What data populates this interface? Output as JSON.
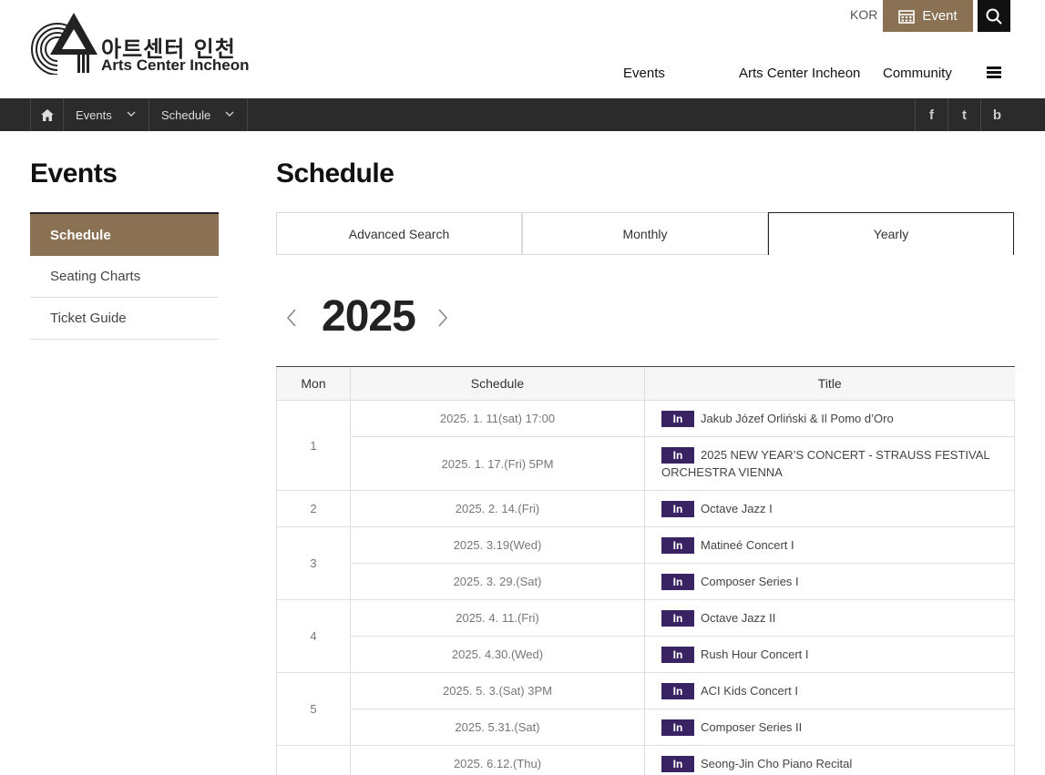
{
  "brand": {
    "name_kr": "아트센터 인천",
    "name_en": "Arts Center Incheon"
  },
  "util": {
    "lang": "KOR",
    "event_label": "Event"
  },
  "gnb": {
    "events": "Events",
    "aci": "Arts Center Incheon",
    "community": "Community"
  },
  "location": {
    "level1": "Events",
    "level2": "Schedule"
  },
  "sns": {
    "facebook": "f",
    "twitter": "t",
    "blog": "b"
  },
  "sidebar": {
    "title": "Events",
    "items": [
      {
        "label": "Schedule",
        "active": true
      },
      {
        "label": "Seating Charts",
        "active": false
      },
      {
        "label": "Ticket Guide",
        "active": false
      }
    ]
  },
  "main": {
    "title": "Schedule",
    "tabs": [
      {
        "label": "Advanced Search"
      },
      {
        "label": "Monthly"
      },
      {
        "label": "Yearly"
      }
    ],
    "year": "2025",
    "table": {
      "headers": [
        "Mon",
        "Schedule",
        "Title"
      ],
      "badge": "In",
      "months": [
        {
          "mon": "1",
          "rows": [
            {
              "date": "2025. 1. 11(sat) 17:00",
              "title": "Jakub Józef Orliński & Il Pomo d’Oro"
            },
            {
              "date": "2025. 1. 17.(Fri) 5PM",
              "title": "2025 NEW YEAR’S CONCERT - STRAUSS FESTIVAL ORCHESTRA VIENNA"
            }
          ]
        },
        {
          "mon": "2",
          "rows": [
            {
              "date": "2025. 2. 14.(Fri)",
              "title": "Octave Jazz I"
            }
          ]
        },
        {
          "mon": "3",
          "rows": [
            {
              "date": "2025. 3.19(Wed)",
              "title": "Matineé Concert I"
            },
            {
              "date": "2025. 3. 29.(Sat)",
              "title": "Composer Series I"
            }
          ]
        },
        {
          "mon": "4",
          "rows": [
            {
              "date": "2025. 4. 11.(Fri)",
              "title": "Octave Jazz II"
            },
            {
              "date": "2025. 4.30.(Wed)",
              "title": "Rush Hour Concert I"
            }
          ]
        },
        {
          "mon": "5",
          "rows": [
            {
              "date": "2025. 5. 3.(Sat) 3PM",
              "title": "ACI Kids Concert I"
            },
            {
              "date": "2025. 5.31.(Sat)",
              "title": "Composer Series II"
            }
          ]
        },
        {
          "mon": "",
          "rows": [
            {
              "date": "2025. 6.12.(Thu)",
              "title": "Seong-Jin Cho Piano Recital"
            }
          ]
        }
      ]
    }
  },
  "colors": {
    "brand_brown": "#8b7153",
    "badge_purple": "#3a2363",
    "locbar_bg": "#2b2b2b"
  }
}
